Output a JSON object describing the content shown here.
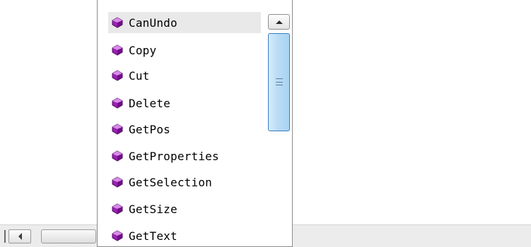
{
  "autocomplete": {
    "selected_index": 0,
    "items": [
      {
        "label": "CanUndo"
      },
      {
        "label": "Copy"
      },
      {
        "label": "Cut"
      },
      {
        "label": "Delete"
      },
      {
        "label": "GetPos"
      },
      {
        "label": "GetProperties"
      },
      {
        "label": "GetSelection"
      },
      {
        "label": "GetSize"
      },
      {
        "label": "GetText"
      }
    ],
    "item_icon": "method-icon",
    "icon_color": "#9b1fb5",
    "selected_background": "#e9e9e9"
  },
  "vertical_scrollbar": {
    "thumb_color": "#b8dcf5",
    "thumb_border": "#3b7bbd"
  }
}
